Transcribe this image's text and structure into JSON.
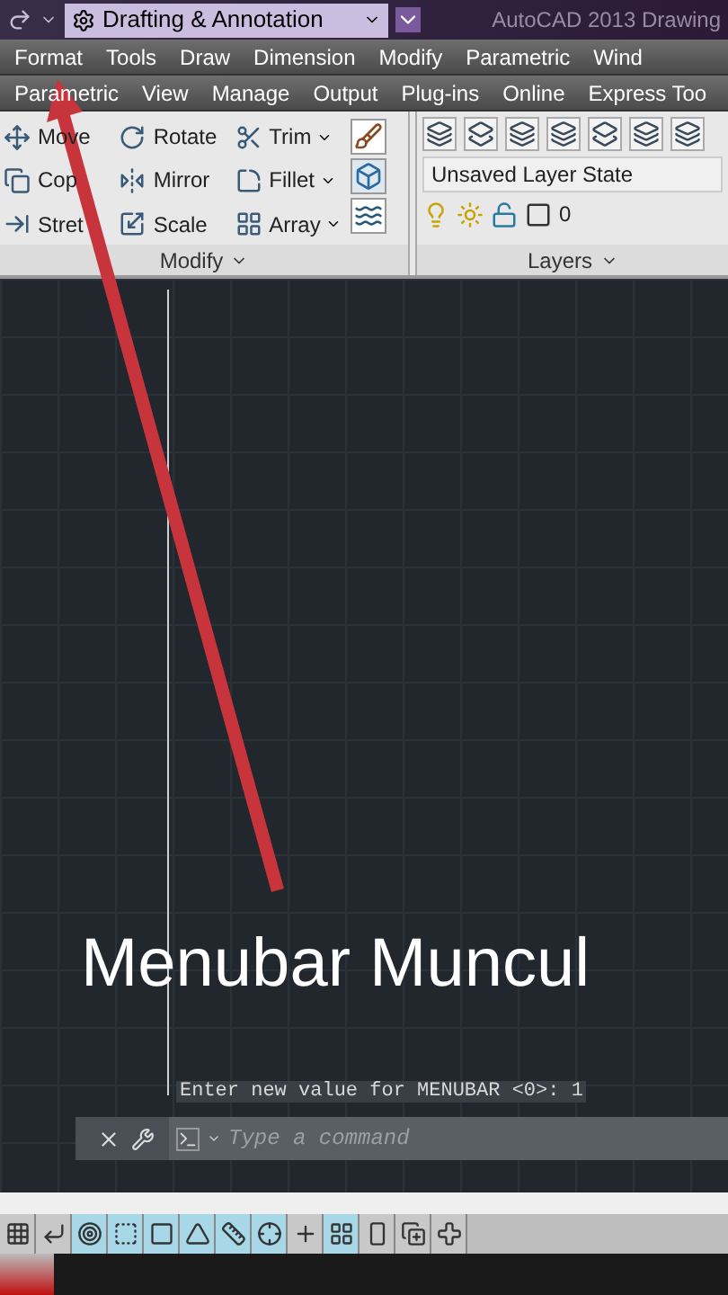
{
  "quick_access": {
    "workspace": "Drafting & Annotation"
  },
  "title": "AutoCAD 2013  Drawing",
  "menubar": [
    {
      "items": [
        "Format",
        "Tools",
        "Draw",
        "Dimension",
        "Modify",
        "Parametric",
        "Wind"
      ]
    },
    {
      "items": [
        "Parametric",
        "View",
        "Manage",
        "Output",
        "Plug-ins",
        "Online",
        "Express Too"
      ]
    }
  ],
  "ribbon": {
    "modify": {
      "title": "Modify",
      "tools": [
        {
          "label": "Move",
          "has_menu": false
        },
        {
          "label": "Rotate",
          "has_menu": false
        },
        {
          "label": "Trim",
          "has_menu": true
        },
        {
          "label": "Cop",
          "has_menu": false
        },
        {
          "label": "Mirror",
          "has_menu": false
        },
        {
          "label": "Fillet",
          "has_menu": true
        },
        {
          "label": "Stret",
          "has_menu": false
        },
        {
          "label": "Scale",
          "has_menu": false
        },
        {
          "label": "Array",
          "has_menu": true
        }
      ]
    },
    "layers": {
      "title": "Layers",
      "layer_state": "Unsaved Layer State",
      "current_layer": "0"
    }
  },
  "command_history": "Enter new value for MENUBAR <0>: 1",
  "command_line": {
    "placeholder": "Type a command"
  },
  "status_toggles": [
    {
      "on": false
    },
    {
      "on": false
    },
    {
      "on": true
    },
    {
      "on": true
    },
    {
      "on": true
    },
    {
      "on": true
    },
    {
      "on": true
    },
    {
      "on": true
    },
    {
      "on": false
    },
    {
      "on": true
    },
    {
      "on": false
    },
    {
      "on": false
    },
    {
      "on": false
    }
  ],
  "caption": "Menubar Muncul"
}
